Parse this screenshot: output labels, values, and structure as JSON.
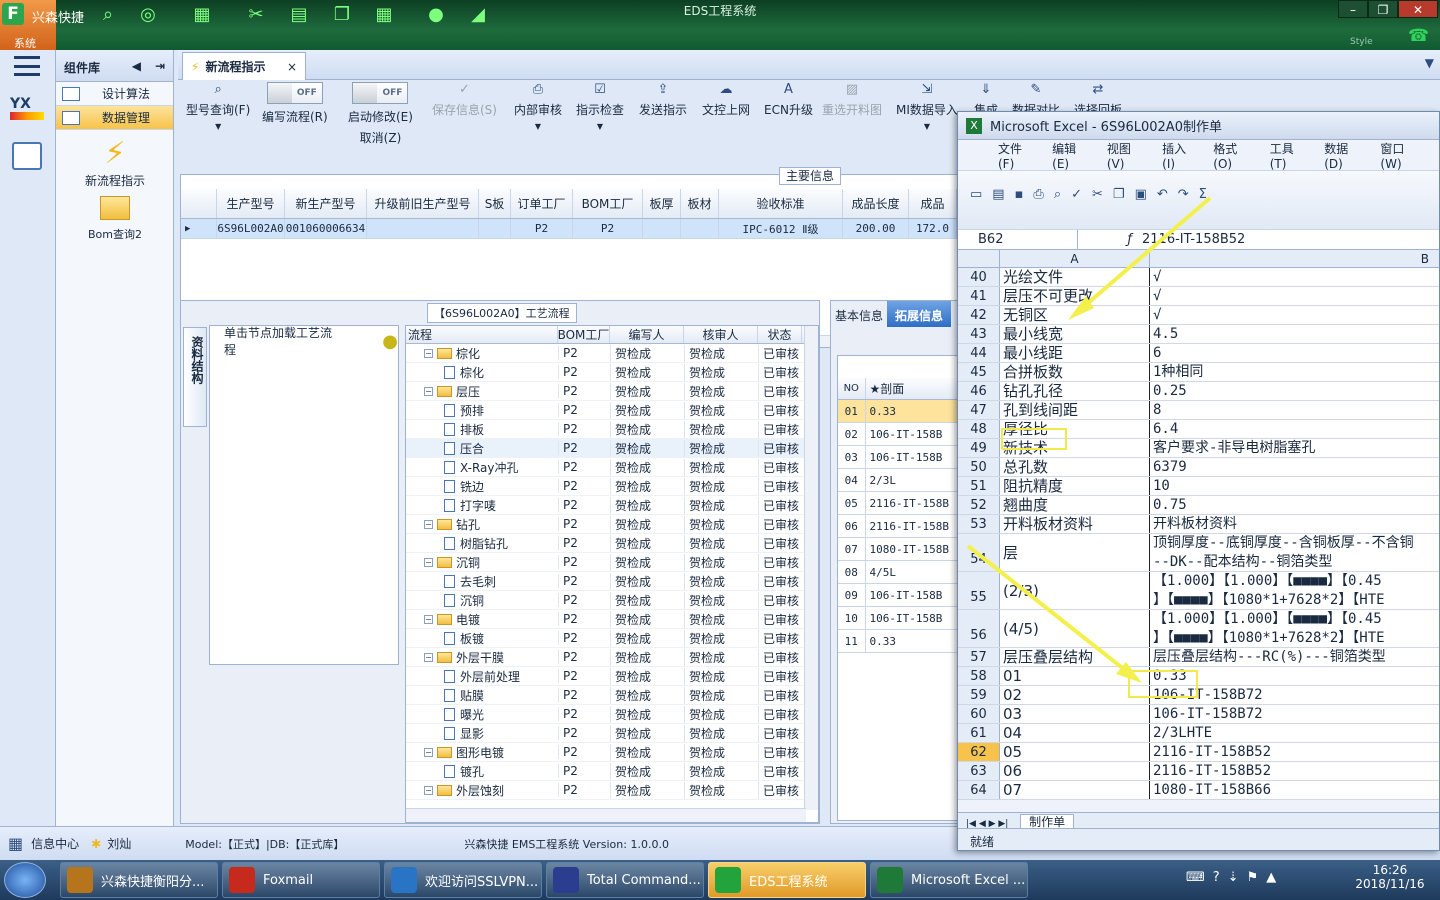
{
  "title_bar": {
    "app_name": "兴森快捷",
    "window_title": "EDS工程系统",
    "system_tab": "系统",
    "style_label": "Style",
    "min": "–",
    "restore": "❐",
    "close": "✕"
  },
  "left_nav": {
    "logo_text": "YX"
  },
  "sidebar": {
    "header": "组件库",
    "items": [
      {
        "label": "设计算法"
      },
      {
        "label": "数据管理"
      }
    ],
    "shortcuts": [
      {
        "label": "新流程指示"
      },
      {
        "label": "Bom查询2"
      }
    ]
  },
  "main_tab": {
    "label": "新流程指示",
    "close": "×"
  },
  "toolbar": [
    {
      "label": "型号查询(F)"
    },
    {
      "label": "编写流程(R)",
      "toggle": "OFF"
    },
    {
      "label": "启动修改(E)",
      "sub": "取消(Z)",
      "toggle": "OFF"
    },
    {
      "label": "保存信息(S)"
    },
    {
      "label": "内部审核"
    },
    {
      "label": "指示检查"
    },
    {
      "label": "发送指示"
    },
    {
      "label": "文控上网"
    },
    {
      "label": "ECN升级"
    },
    {
      "label": "重选开料图"
    },
    {
      "label": "MI数据导入"
    },
    {
      "label": "集成"
    },
    {
      "label": "数据对比"
    },
    {
      "label": "选择回板"
    }
  ],
  "main_info": {
    "section_title": "主要信息",
    "headers": [
      "生产型号",
      "新生产型号",
      "升级前旧生产型号",
      "S板",
      "订单工厂",
      "BOM工厂",
      "板厚",
      "板材",
      "验收标准",
      "成品长度",
      "成品"
    ],
    "row": [
      "6S96L002A0",
      "10010600066342",
      "",
      "",
      "P2",
      "P2",
      "",
      "",
      "IPC-6012 Ⅱ级",
      "200.00",
      "172.0"
    ]
  },
  "process": {
    "section_title": "【6S96L002A0】工艺流程",
    "vertical_tab": "资料结构",
    "load_hint": "单击节点加载工艺流程",
    "headers": [
      "流程",
      "BOM工厂",
      "编写人",
      "核审人",
      "状态"
    ],
    "rows": [
      {
        "name": "棕化",
        "folder": true,
        "bom": "P2",
        "writer": "贺检成",
        "reviewer": "贺检成",
        "status": "已审核"
      },
      {
        "name": "棕化",
        "folder": false,
        "bom": "P2",
        "writer": "贺检成",
        "reviewer": "贺检成",
        "status": "已审核"
      },
      {
        "name": "层压",
        "folder": true,
        "bom": "P2",
        "writer": "贺检成",
        "reviewer": "贺检成",
        "status": "已审核"
      },
      {
        "name": "预排",
        "folder": false,
        "bom": "P2",
        "writer": "贺检成",
        "reviewer": "贺检成",
        "status": "已审核"
      },
      {
        "name": "排板",
        "folder": false,
        "bom": "P2",
        "writer": "贺检成",
        "reviewer": "贺检成",
        "status": "已审核"
      },
      {
        "name": "压合",
        "folder": false,
        "bom": "P2",
        "writer": "贺检成",
        "reviewer": "贺检成",
        "status": "已审核"
      },
      {
        "name": "X-Ray冲孔",
        "folder": false,
        "bom": "P2",
        "writer": "贺检成",
        "reviewer": "贺检成",
        "status": "已审核"
      },
      {
        "name": "铣边",
        "folder": false,
        "bom": "P2",
        "writer": "贺检成",
        "reviewer": "贺检成",
        "status": "已审核"
      },
      {
        "name": "打字唛",
        "folder": false,
        "bom": "P2",
        "writer": "贺检成",
        "reviewer": "贺检成",
        "status": "已审核"
      },
      {
        "name": "钻孔",
        "folder": true,
        "bom": "P2",
        "writer": "贺检成",
        "reviewer": "贺检成",
        "status": "已审核"
      },
      {
        "name": "树脂钻孔",
        "folder": false,
        "bom": "P2",
        "writer": "贺检成",
        "reviewer": "贺检成",
        "status": "已审核"
      },
      {
        "name": "沉铜",
        "folder": true,
        "bom": "P2",
        "writer": "贺检成",
        "reviewer": "贺检成",
        "status": "已审核"
      },
      {
        "name": "去毛刺",
        "folder": false,
        "bom": "P2",
        "writer": "贺检成",
        "reviewer": "贺检成",
        "status": "已审核"
      },
      {
        "name": "沉铜",
        "folder": false,
        "bom": "P2",
        "writer": "贺检成",
        "reviewer": "贺检成",
        "status": "已审核"
      },
      {
        "name": "电镀",
        "folder": true,
        "bom": "P2",
        "writer": "贺检成",
        "reviewer": "贺检成",
        "status": "已审核"
      },
      {
        "name": "板镀",
        "folder": false,
        "bom": "P2",
        "writer": "贺检成",
        "reviewer": "贺检成",
        "status": "已审核"
      },
      {
        "name": "外层干膜",
        "folder": true,
        "bom": "P2",
        "writer": "贺检成",
        "reviewer": "贺检成",
        "status": "已审核"
      },
      {
        "name": "外层前处理",
        "folder": false,
        "bom": "P2",
        "writer": "贺检成",
        "reviewer": "贺检成",
        "status": "已审核"
      },
      {
        "name": "贴膜",
        "folder": false,
        "bom": "P2",
        "writer": "贺检成",
        "reviewer": "贺检成",
        "status": "已审核"
      },
      {
        "name": "曝光",
        "folder": false,
        "bom": "P2",
        "writer": "贺检成",
        "reviewer": "贺检成",
        "status": "已审核"
      },
      {
        "name": "显影",
        "folder": false,
        "bom": "P2",
        "writer": "贺检成",
        "reviewer": "贺检成",
        "status": "已审核"
      },
      {
        "name": "图形电镀",
        "folder": true,
        "bom": "P2",
        "writer": "贺检成",
        "reviewer": "贺检成",
        "status": "已审核"
      },
      {
        "name": "镀孔",
        "folder": false,
        "bom": "P2",
        "writer": "贺检成",
        "reviewer": "贺检成",
        "status": "已审核"
      },
      {
        "name": "外层蚀刻",
        "folder": true,
        "bom": "P2",
        "writer": "贺检成",
        "reviewer": "贺检成",
        "status": "已审核"
      }
    ]
  },
  "right_panel": {
    "tabs": [
      "基本信息",
      "拓展信息"
    ],
    "headers": [
      "NO",
      "★剖面"
    ],
    "rows": [
      [
        "01",
        "0.33"
      ],
      [
        "02",
        "106-IT-158B"
      ],
      [
        "03",
        "106-IT-158B"
      ],
      [
        "04",
        "2/3L"
      ],
      [
        "05",
        "2116-IT-158B"
      ],
      [
        "06",
        "2116-IT-158B"
      ],
      [
        "07",
        "1080-IT-158B"
      ],
      [
        "08",
        "4/5L"
      ],
      [
        "09",
        "106-IT-158B"
      ],
      [
        "10",
        "106-IT-158B"
      ],
      [
        "11",
        "0.33"
      ]
    ]
  },
  "status_bar": {
    "info_center": "信息中心",
    "user": "刘灿",
    "model": "Model:【正式】|DB:【正式库】",
    "version": "兴森快捷  EMS工程系统  Version: 1.0.0.0"
  },
  "excel": {
    "title": "Microsoft Excel - 6S96L002A0制作单",
    "menu": [
      "文件(F)",
      "编辑(E)",
      "视图(V)",
      "插入(I)",
      "格式(O)",
      "工具(T)",
      "数据(D)",
      "窗口(W)"
    ],
    "cell_ref": "B62",
    "formula": "2116-IT-158B52",
    "col_a": "A",
    "col_b": "B",
    "sheet_tab": "制作单",
    "status": "就绪",
    "rows": [
      {
        "n": "40",
        "a": "光绘文件",
        "b": "√"
      },
      {
        "n": "41",
        "a": "层压不可更改",
        "b": "√"
      },
      {
        "n": "42",
        "a": "无铜区",
        "b": "√"
      },
      {
        "n": "43",
        "a": "最小线宽",
        "b": "4.5"
      },
      {
        "n": "44",
        "a": "最小线距",
        "b": "6"
      },
      {
        "n": "45",
        "a": "合拼板数",
        "b": "1种相同"
      },
      {
        "n": "46",
        "a": "钻孔孔径",
        "b": "0.25"
      },
      {
        "n": "47",
        "a": "孔到线间距",
        "b": "8"
      },
      {
        "n": "48",
        "a": "厚径比",
        "b": "6.4"
      },
      {
        "n": "49",
        "a": "新技术",
        "b": "客户要求-非导电树脂塞孔"
      },
      {
        "n": "50",
        "a": "总孔数",
        "b": "6379"
      },
      {
        "n": "51",
        "a": "阻抗精度",
        "b": "10"
      },
      {
        "n": "52",
        "a": "翘曲度",
        "b": "0.75"
      },
      {
        "n": "53",
        "a": "开料板材资料",
        "b": "开料板材资料"
      },
      {
        "n": "54",
        "a": "层",
        "b": "顶铜厚度--底铜厚度--含铜板厚--不含铜",
        "b2": "--DK--配本结构--铜箔类型",
        "tall": true
      },
      {
        "n": "55",
        "a": "(2/3)",
        "b": "【1.000】【1.000】【■■■■】【0.45",
        "b2": "】【■■■■】【1080*1+7628*2】【HTE",
        "tall": true
      },
      {
        "n": "56",
        "a": "(4/5)",
        "b": "【1.000】【1.000】【■■■■】【0.45",
        "b2": "】【■■■■】【1080*1+7628*2】【HTE",
        "tall": true
      },
      {
        "n": "57",
        "a": "层压叠层结构",
        "b": "层压叠层结构---RC(%)---铜箔类型"
      },
      {
        "n": "58",
        "a": "01",
        "b": "0.33"
      },
      {
        "n": "59",
        "a": "02",
        "b": "106-IT-158B72"
      },
      {
        "n": "60",
        "a": "03",
        "b": "106-IT-158B72"
      },
      {
        "n": "61",
        "a": "04",
        "b": "2/3LHTE"
      },
      {
        "n": "62",
        "a": "05",
        "b": "2116-IT-158B52"
      },
      {
        "n": "63",
        "a": "06",
        "b": "2116-IT-158B52"
      },
      {
        "n": "64",
        "a": "07",
        "b": "1080-IT-158B66"
      }
    ]
  },
  "taskbar": {
    "items": [
      {
        "label": "兴森快捷衡阳分...",
        "color": "#b6751c"
      },
      {
        "label": "Foxmail",
        "color": "#c62a1c"
      },
      {
        "label": "欢迎访问SSLVPN...",
        "color": "#2a74c6"
      },
      {
        "label": "Total Command...",
        "color": "#2a3d8f"
      },
      {
        "label": "EDS工程系统",
        "color": "#23a33c"
      },
      {
        "label": "Microsoft Excel ...",
        "color": "#1f7a3a"
      }
    ],
    "time": "16:26",
    "date": "2018/11/16"
  },
  "colors": {
    "accent": "#f7c34a",
    "selected_row": "#cfe3fb",
    "highlight_box": "#f3e94b"
  }
}
